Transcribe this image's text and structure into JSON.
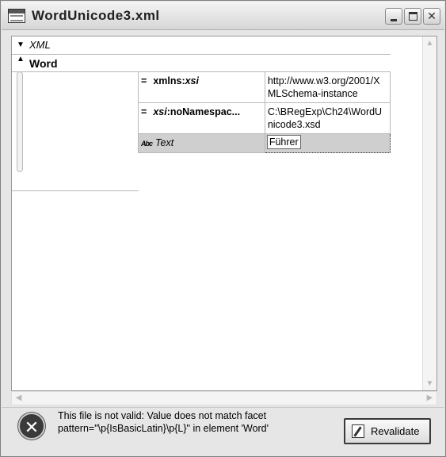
{
  "window": {
    "title": "WordUnicode3.xml",
    "controls": {
      "minimize": "_",
      "maximize": "□",
      "close": "✕"
    }
  },
  "tree": {
    "root": {
      "label": "XML",
      "expander": "▼"
    },
    "element": {
      "label": "Word",
      "expander": "▲",
      "attributes": [
        {
          "marker": "=",
          "prefix": "xmlns:",
          "name": "xsi",
          "value": "http://www.w3.org/2001/XMLSchema-instance"
        },
        {
          "marker": "=",
          "prefix": "xsi",
          "name": ":noNamespac...",
          "value": "C:\\BRegExp\\Ch24\\WordUnicode3.xsd"
        }
      ],
      "text_node": {
        "icon": "Abc",
        "label": "Text",
        "value": "Führer"
      }
    }
  },
  "status": {
    "message": "This file is not valid: Value does not match facet pattern=\"\\p{IsBasicLatin}\\p{L}\" in element 'Word'",
    "revalidate_label": "Revalidate"
  },
  "icons": {
    "window": "xml-file-icon",
    "error": "error-x-icon",
    "revalidate": "revalidate-pencil-icon"
  }
}
